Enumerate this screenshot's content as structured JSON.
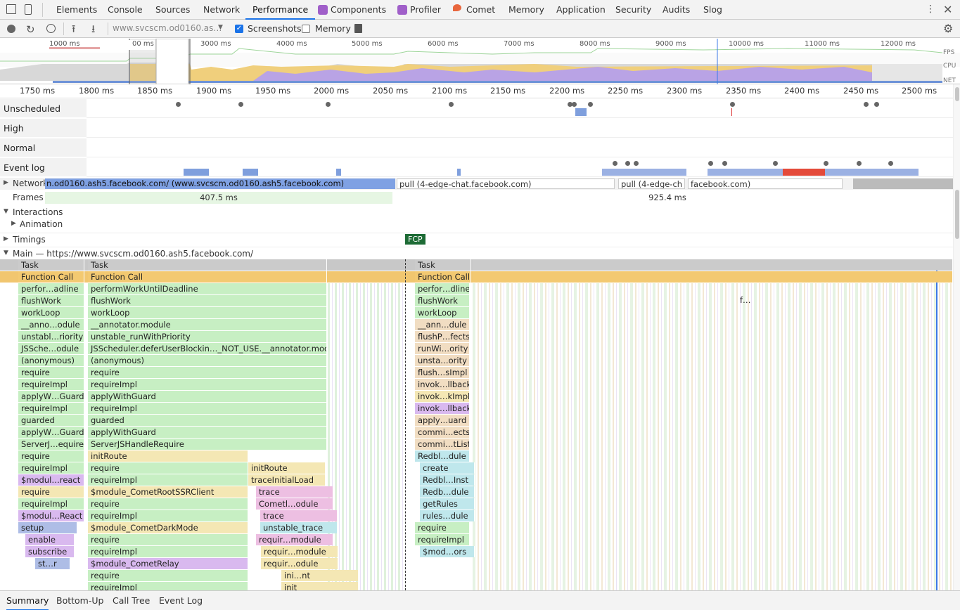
{
  "tabs": [
    "Elements",
    "Console",
    "Sources",
    "Network",
    "Performance",
    "Components",
    "Profiler",
    "Comet",
    "Memory",
    "Application",
    "Security",
    "Audits",
    "Slog"
  ],
  "toolbar": {
    "url": "www.svcscm.od0160.as…",
    "screenshots": "Screenshots",
    "memory": "Memory",
    "screenshots_checked": true,
    "memory_checked": false
  },
  "overview": {
    "ticks": [
      "1000 ms",
      "2000 ms",
      "3000 ms",
      "4000 ms",
      "5000 ms",
      "6000 ms",
      "7000 ms",
      "8000 ms",
      "9000 ms",
      "10000 ms",
      "11000 ms",
      "12000 ms"
    ],
    "fps": "FPS",
    "cpu": "CPU",
    "net": "NET",
    "selection_label": "00 ms"
  },
  "ruler": [
    "1750 ms",
    "1800 ms",
    "1850 ms",
    "1900 ms",
    "1950 ms",
    "2000 ms",
    "2050 ms",
    "2100 ms",
    "2150 ms",
    "2200 ms",
    "2250 ms",
    "2300 ms",
    "2350 ms",
    "2400 ms",
    "2450 ms",
    "2500 ms"
  ],
  "lanes": [
    "Unscheduled",
    "High",
    "Normal",
    "Event log"
  ],
  "network": {
    "label": "Network",
    "req1": "n.od0160.ash5.facebook.com/ (www.svcscm.od0160.ash5.facebook.com)",
    "req2": "pull (4-edge-chat.facebook.com)",
    "req3": "pull (4-edge-ch",
    "req4": "facebook.com)"
  },
  "frames": {
    "label": "Frames",
    "f1": "407.5 ms",
    "f2": "925.4 ms"
  },
  "interactions": {
    "label": "Interactions",
    "animation": "Animation"
  },
  "timings": {
    "label": "Timings",
    "fcp": "FCP"
  },
  "main": {
    "label": "Main — https://www.svcscm.od0160.ash5.facebook.com/"
  },
  "flame": {
    "col1": [
      "Task",
      "Function Call",
      "perfor…adline",
      "flushWork",
      "workLoop",
      "__anno…odule",
      "unstabl…riority",
      "JSSche…odule",
      "(anonymous)",
      "require",
      "requireImpl",
      "applyW…Guard",
      "requireImpl",
      "guarded",
      "applyW…Guard",
      "ServerJ…equire",
      "require",
      "requireImpl",
      "$modul…react",
      "require",
      "requireImpl",
      "$modul…React",
      "setup",
      "enable",
      "subscribe",
      "st…r"
    ],
    "col2": [
      "Task",
      "Function Call",
      "performWorkUntilDeadline",
      "flushWork",
      "workLoop",
      "__annotator.module",
      "unstable_runWithPriority",
      "JSScheduler.deferUserBlockin…_NOT_USE.__annotator.module",
      "(anonymous)",
      "require",
      "requireImpl",
      "applyWithGuard",
      "requireImpl",
      "guarded",
      "applyWithGuard",
      "ServerJSHandleRequire",
      "initRoute",
      "require",
      "requireImpl",
      "$module_CometRootSSRClient",
      "require",
      "requireImpl",
      "$module_CometDarkMode",
      "require",
      "requireImpl",
      "$module_CometRelay",
      "require",
      "requireImpl"
    ],
    "col3": [
      "initRoute",
      "traceInitialLoad",
      "trace",
      "Cometl…odule",
      "trace",
      "unstable_trace",
      "requir…module",
      "requir…module",
      "requir…odule",
      "ini…nt",
      "init"
    ],
    "col4": [
      "Task",
      "Function Call",
      "perfor…dline",
      "flushWork",
      "workLoop",
      "__ann…dule",
      "flushP…fects",
      "runWi…ority",
      "unsta…ority",
      "flush…sImpl",
      "invok…llback",
      "invok…kImpl",
      "invok…llback",
      "apply…uard",
      "commi…ects",
      "commi…tList",
      "Redbl…dule",
      "create",
      "Redbl…Inst",
      "Redb…dule",
      "getRules",
      "rules…dule",
      "require",
      "requireImpl",
      "$mod…ors"
    ],
    "f_label": "f…"
  },
  "bottom_tabs": [
    "Summary",
    "Bottom-Up",
    "Call Tree",
    "Event Log"
  ]
}
